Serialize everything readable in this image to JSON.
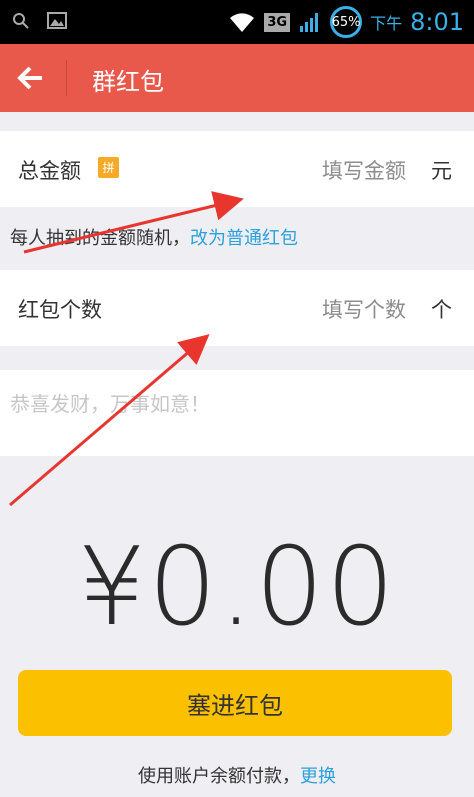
{
  "status_bar": {
    "network": "3G",
    "battery": "65%",
    "time_label": "下午",
    "time": "8:01"
  },
  "header": {
    "title": "群红包"
  },
  "amount_row": {
    "label": "总金额",
    "pin_badge": "拼",
    "placeholder": "填写金额",
    "unit": "元"
  },
  "hint": {
    "text": "每人抽到的金额随机，",
    "link": "改为普通红包"
  },
  "count_row": {
    "label": "红包个数",
    "placeholder": "填写个数",
    "unit": "个"
  },
  "greeting": {
    "placeholder": "恭喜发财，万事如意！"
  },
  "total": {
    "display": "¥0.00"
  },
  "submit": {
    "label": "塞进红包"
  },
  "footer": {
    "text": "使用账户余额付款，",
    "link": "更换"
  },
  "colors": {
    "header": "#e8584b",
    "button": "#fbc100",
    "link": "#2aa0dd",
    "annotation_arrow": "#e8352e"
  }
}
